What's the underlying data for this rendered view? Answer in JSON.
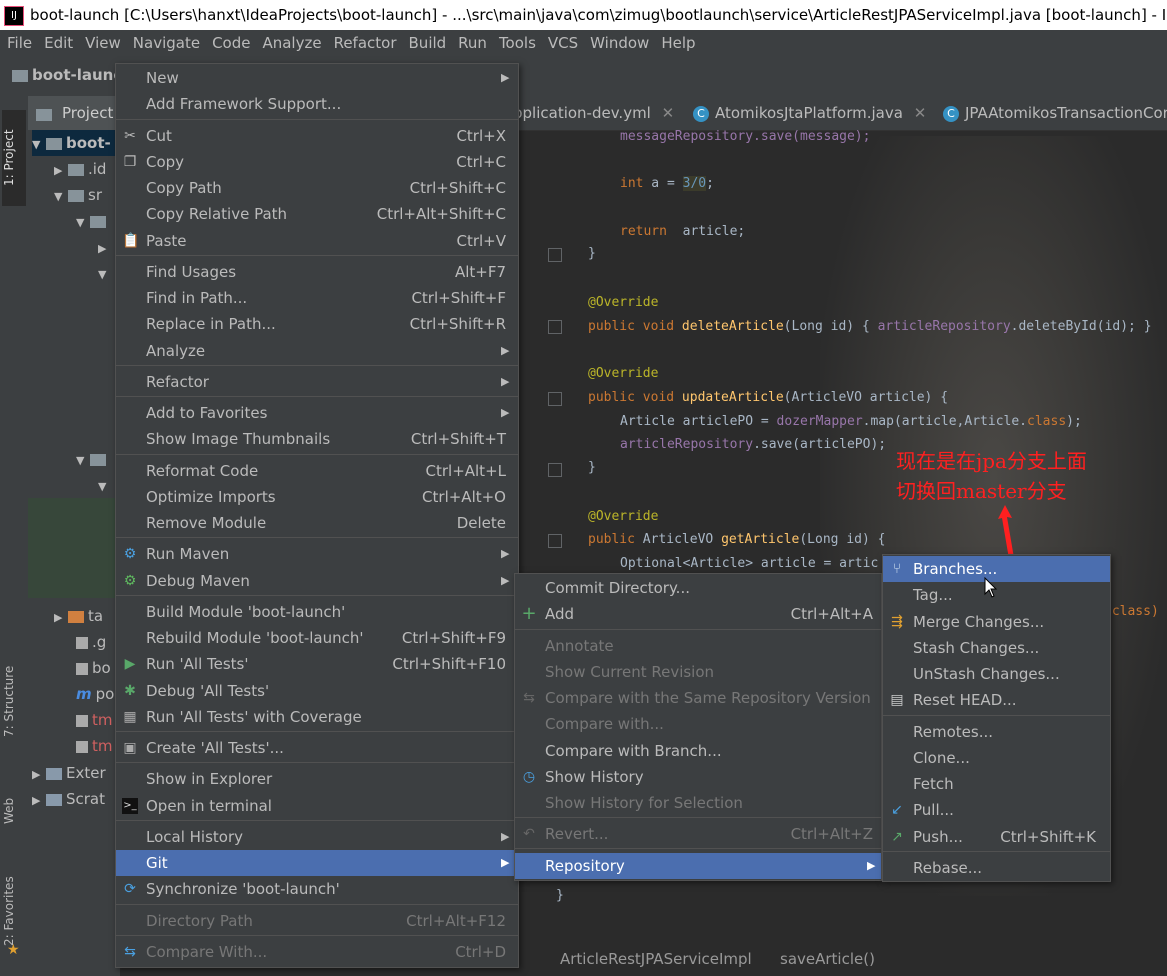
{
  "window": {
    "title": "boot-launch [C:\\Users\\hanxt\\IdeaProjects\\boot-launch] - ...\\src\\main\\java\\com\\zimug\\bootlaunch\\service\\ArticleRestJPAServiceImpl.java [boot-launch] - Intel"
  },
  "menubar": [
    "File",
    "Edit",
    "View",
    "Navigate",
    "Code",
    "Analyze",
    "Refactor",
    "Build",
    "Run",
    "Tools",
    "VCS",
    "Window",
    "Help"
  ],
  "navbar": {
    "project": "boot-launc"
  },
  "side_tabs": {
    "project": "1: Project",
    "structure": "7: Structure",
    "web": "Web",
    "favorites": "2: Favorites"
  },
  "project_panel": {
    "header": "Project",
    "rows": [
      {
        "label": "boot-"
      },
      {
        "label": ".id"
      },
      {
        "label": "sr"
      },
      {
        "label": ""
      },
      {
        "label": ""
      },
      {
        "label": ""
      },
      {
        "label": ""
      },
      {
        "label": ""
      },
      {
        "label": "ta"
      },
      {
        "label": ".g"
      },
      {
        "label": "bo"
      },
      {
        "label": "po"
      },
      {
        "label": "tm"
      },
      {
        "label": "tm"
      },
      {
        "label": "Exter"
      },
      {
        "label": "Scrat"
      }
    ]
  },
  "editor_tabs": [
    {
      "label": "pplication-dev.yml"
    },
    {
      "label": "AtomikosJtaPlatform.java"
    },
    {
      "label": "JPAAtomikosTransactionCor"
    }
  ],
  "code_lines": {
    "l1": "messageRepository.save(message);",
    "l2_kw": "int",
    "l2_rest": " a = ",
    "l2_num": "3/0",
    "l2_end": ";",
    "l3_kw": "return",
    "l3_rest": "  article;",
    "brace": "}",
    "override": "@Override",
    "del_kw": "public void ",
    "del_fn": "deleteArticle",
    "del_args": "(Long id) { ",
    "del_fld": "articleRepository",
    "del_rest": ".deleteById(id); }",
    "upd_fn": "updateArticle",
    "upd_args": "(ArticleVO article) {",
    "upd_l1a": "Article articlePO = ",
    "upd_l1b": "dozerMapper",
    "upd_l1c": ".map(article,Article.",
    "upd_l1d": "class",
    "upd_l1e": ");",
    "upd_l2a": "articleRepository",
    "upd_l2b": ".save(articlePO);",
    "get_kw": "public ",
    "get_type": "ArticleVO ",
    "get_fn": "getArticle",
    "get_args": "(Long id) {",
    "get_l1": "Optional<Article> article = artic",
    "class_frag": ".class)",
    "close_brace": "}"
  },
  "context_menu": {
    "items": [
      {
        "label": "New",
        "shortcut": "",
        "submenu": true
      },
      {
        "label": "Add Framework Support...",
        "shortcut": ""
      },
      {
        "label": "Cut",
        "shortcut": "Ctrl+X",
        "icon": "scissors-icon"
      },
      {
        "label": "Copy",
        "shortcut": "Ctrl+C",
        "icon": "copy-icon"
      },
      {
        "label": "Copy Path",
        "shortcut": "Ctrl+Shift+C"
      },
      {
        "label": "Copy Relative Path",
        "shortcut": "Ctrl+Alt+Shift+C"
      },
      {
        "label": "Paste",
        "shortcut": "Ctrl+V",
        "icon": "paste-icon"
      },
      {
        "label": "Find Usages",
        "shortcut": "Alt+F7"
      },
      {
        "label": "Find in Path...",
        "shortcut": "Ctrl+Shift+F"
      },
      {
        "label": "Replace in Path...",
        "shortcut": "Ctrl+Shift+R"
      },
      {
        "label": "Analyze",
        "shortcut": "",
        "submenu": true
      },
      {
        "label": "Refactor",
        "shortcut": "",
        "submenu": true
      },
      {
        "label": "Add to Favorites",
        "shortcut": "",
        "submenu": true
      },
      {
        "label": "Show Image Thumbnails",
        "shortcut": "Ctrl+Shift+T"
      },
      {
        "label": "Reformat Code",
        "shortcut": "Ctrl+Alt+L"
      },
      {
        "label": "Optimize Imports",
        "shortcut": "Ctrl+Alt+O"
      },
      {
        "label": "Remove Module",
        "shortcut": "Delete"
      },
      {
        "label": "Run Maven",
        "shortcut": "",
        "submenu": true,
        "icon": "maven-gear-icon"
      },
      {
        "label": "Debug Maven",
        "shortcut": "",
        "submenu": true,
        "icon": "maven-debug-icon"
      },
      {
        "label": "Build Module 'boot-launch'",
        "shortcut": ""
      },
      {
        "label": "Rebuild Module 'boot-launch'",
        "shortcut": "Ctrl+Shift+F9"
      },
      {
        "label": "Run 'All Tests'",
        "shortcut": "Ctrl+Shift+F10",
        "icon": "run-icon"
      },
      {
        "label": "Debug 'All Tests'",
        "shortcut": "",
        "icon": "debug-icon"
      },
      {
        "label": "Run 'All Tests' with Coverage",
        "shortcut": "",
        "icon": "coverage-icon"
      },
      {
        "label": "Create 'All Tests'...",
        "shortcut": "",
        "icon": "create-test-icon"
      },
      {
        "label": "Show in Explorer",
        "shortcut": ""
      },
      {
        "label": "Open in terminal",
        "shortcut": "",
        "icon": "terminal-icon"
      },
      {
        "label": "Local History",
        "shortcut": "",
        "submenu": true
      },
      {
        "label": "Git",
        "shortcut": "",
        "submenu": true,
        "selected": true
      },
      {
        "label": "Synchronize 'boot-launch'",
        "shortcut": "",
        "icon": "sync-icon"
      },
      {
        "label": "Directory Path",
        "shortcut": "Ctrl+Alt+F12"
      },
      {
        "label": "Compare With...",
        "shortcut": "Ctrl+D",
        "icon": "compare-icon"
      }
    ]
  },
  "git_menu": {
    "items": [
      {
        "label": "Commit Directory...",
        "shortcut": ""
      },
      {
        "label": "Add",
        "shortcut": "Ctrl+Alt+A",
        "icon": "plus-icon"
      },
      {
        "label": "Annotate",
        "shortcut": "",
        "disabled": true
      },
      {
        "label": "Show Current Revision",
        "shortcut": "",
        "disabled": true
      },
      {
        "label": "Compare with the Same Repository Version",
        "shortcut": "",
        "disabled": true,
        "icon": "compare-icon"
      },
      {
        "label": "Compare with...",
        "shortcut": "",
        "disabled": true
      },
      {
        "label": "Compare with Branch...",
        "shortcut": ""
      },
      {
        "label": "Show History",
        "shortcut": "",
        "icon": "history-icon"
      },
      {
        "label": "Show History for Selection",
        "shortcut": "",
        "disabled": true
      },
      {
        "label": "Revert...",
        "shortcut": "Ctrl+Alt+Z",
        "disabled": true,
        "icon": "revert-icon"
      },
      {
        "label": "Repository",
        "shortcut": "",
        "submenu": true,
        "selected": true
      }
    ]
  },
  "repo_menu": {
    "items": [
      {
        "label": "Branches...",
        "shortcut": "",
        "selected": true,
        "icon": "branch-icon"
      },
      {
        "label": "Tag...",
        "shortcut": ""
      },
      {
        "label": "Merge Changes...",
        "shortcut": "",
        "icon": "merge-icon"
      },
      {
        "label": "Stash Changes...",
        "shortcut": ""
      },
      {
        "label": "UnStash Changes...",
        "shortcut": ""
      },
      {
        "label": "Reset HEAD...",
        "shortcut": "",
        "icon": "reset-icon"
      },
      {
        "label": "Remotes...",
        "shortcut": ""
      },
      {
        "label": "Clone...",
        "shortcut": ""
      },
      {
        "label": "Fetch",
        "shortcut": ""
      },
      {
        "label": "Pull...",
        "shortcut": "",
        "icon": "pull-icon"
      },
      {
        "label": "Push...",
        "shortcut": "Ctrl+Shift+K",
        "icon": "push-icon"
      },
      {
        "label": "Rebase...",
        "shortcut": ""
      }
    ]
  },
  "annotation": {
    "line1": "现在是在jpa分支上面",
    "line2": "切换回master分支"
  },
  "statusbar": {
    "class": "ArticleRestJPAServiceImpl",
    "method": "saveArticle()"
  },
  "colors": {
    "selection": "#4b6eaf",
    "menu_bg": "#3c3f41",
    "annotation": "#ff2020"
  }
}
